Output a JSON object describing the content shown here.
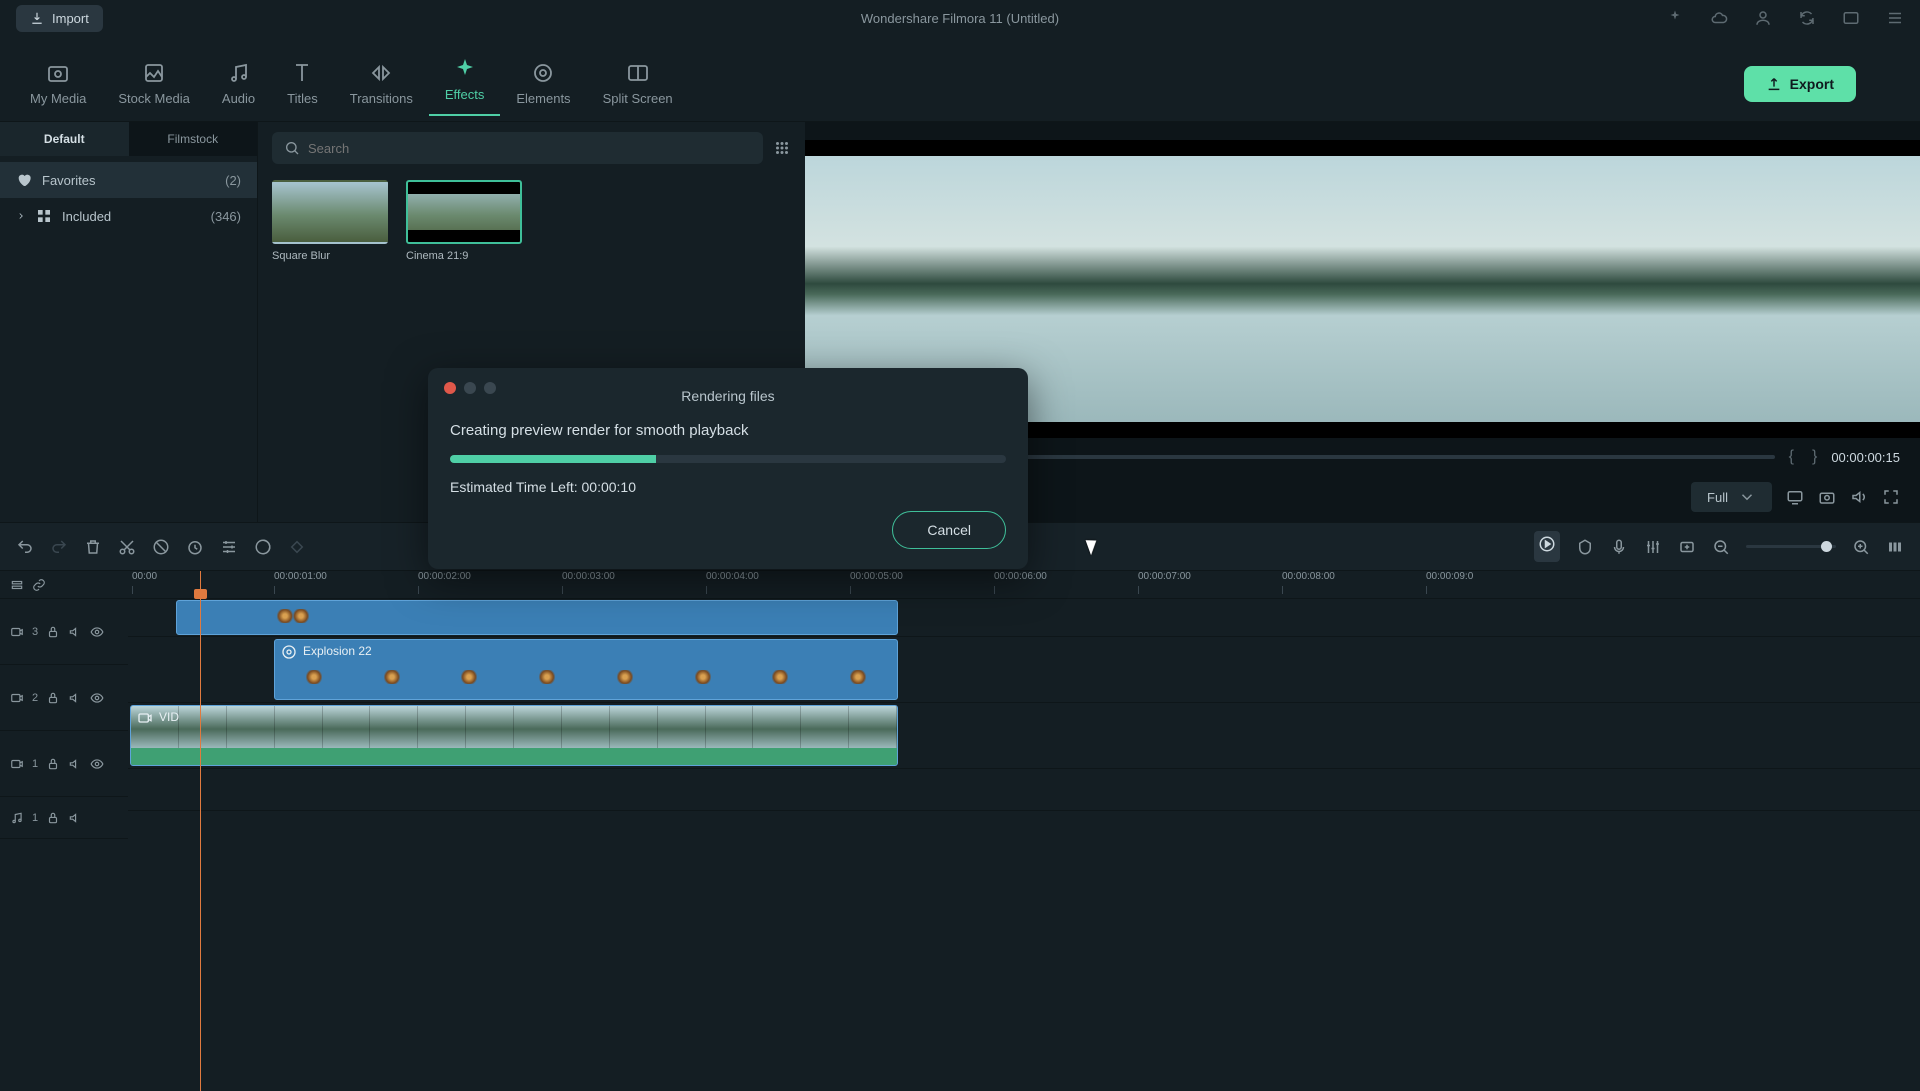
{
  "titlebar": {
    "import": "Import",
    "title": "Wondershare Filmora 11 (Untitled)"
  },
  "tabs": {
    "my_media": "My Media",
    "stock_media": "Stock Media",
    "audio": "Audio",
    "titles": "Titles",
    "transitions": "Transitions",
    "effects": "Effects",
    "elements": "Elements",
    "split_screen": "Split Screen",
    "export": "Export"
  },
  "subtabs": {
    "default": "Default",
    "filmstock": "Filmstock"
  },
  "categories": {
    "favorites": {
      "label": "Favorites",
      "count": "(2)"
    },
    "included": {
      "label": "Included",
      "count": "(346)"
    }
  },
  "search": {
    "placeholder": "Search"
  },
  "thumbs": {
    "square_blur": "Square Blur",
    "cinema": "Cinema 21:9"
  },
  "preview": {
    "timecode": "00:00:00:15",
    "quality": "Full"
  },
  "modal": {
    "title": "Rendering files",
    "message": "Creating preview render for smooth playback",
    "eta": "Estimated Time Left: 00:00:10",
    "cancel": "Cancel",
    "progress_percent": 37
  },
  "timeline": {
    "ticks": [
      "00:00",
      "00:00:01:00",
      "00:00:02:00",
      "00:00:03:00",
      "00:00:04:00",
      "00:00:05:00",
      "00:00:06:00",
      "00:00:07:00",
      "00:00:08:00",
      "00:00:09:0"
    ],
    "tracks": {
      "t3": "3",
      "t2": "2",
      "t1": "1",
      "a1": "1"
    },
    "clips": {
      "explosion": "Explosion 22",
      "vid": "VID"
    }
  }
}
